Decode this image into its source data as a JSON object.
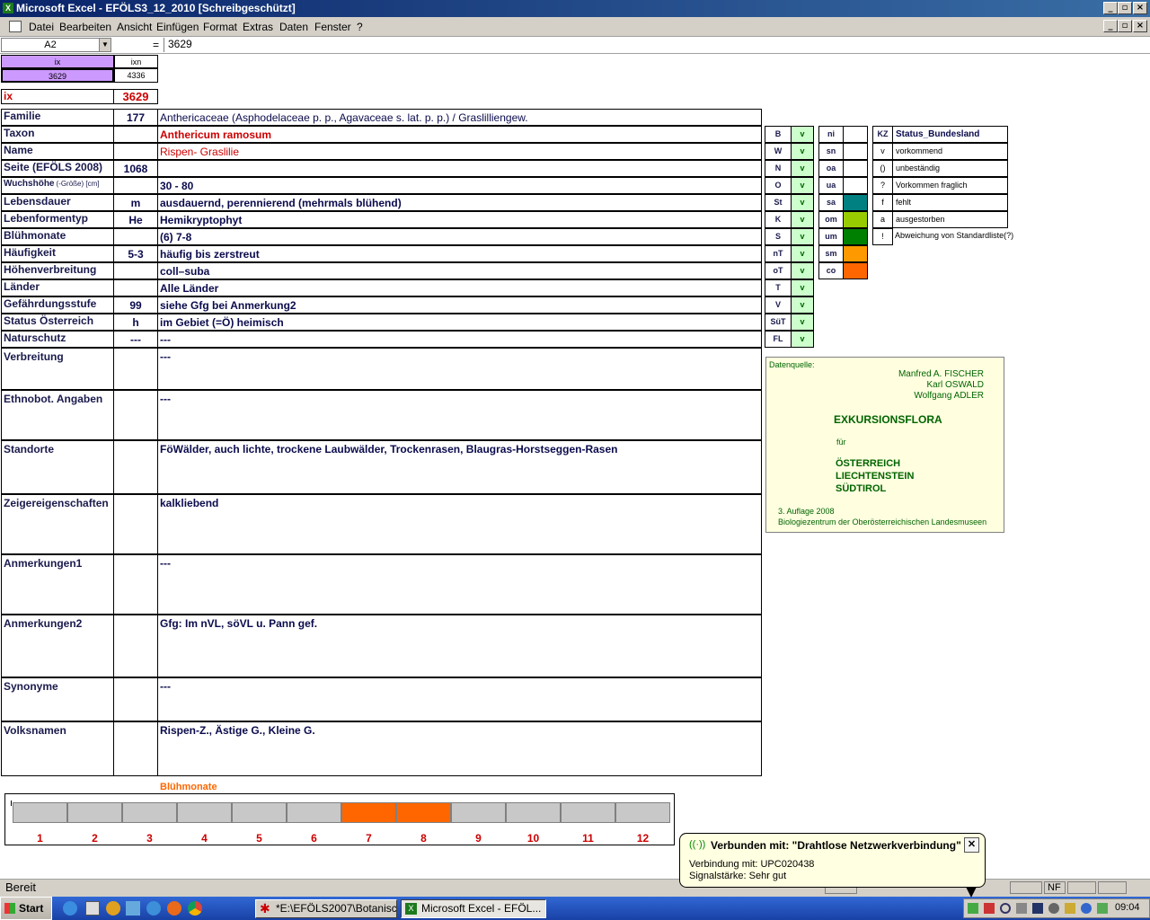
{
  "window": {
    "title": "Microsoft Excel - EFÖLS3_12_2010  [Schreibgeschützt]"
  },
  "menu": {
    "items": [
      "Datei",
      "Bearbeiten",
      "Ansicht",
      "Einfügen",
      "Format",
      "Extras",
      "Daten",
      "Fenster",
      "?"
    ]
  },
  "formula": {
    "namebox": "A2",
    "eq": "=",
    "content": "3629"
  },
  "top": {
    "ix_hdr": "ix",
    "ixn_hdr": "ixn",
    "ix_val": "3629",
    "ixn_val": "4336",
    "ix_label": "ix",
    "ix_big": "3629"
  },
  "rows": [
    {
      "label": "Familie",
      "code": "177",
      "value": "Anthericaceae (Asphodelaceae p. p., Agavaceae s. lat. p. p.)  /  Graslilliengew."
    },
    {
      "label": "Taxon",
      "code": "",
      "value": "Anthericum ramosum"
    },
    {
      "label": "Name",
      "code": "",
      "value": "Rispen- Graslilie"
    },
    {
      "label": "Seite (EFÖLS 2008)",
      "code": "1068",
      "value": ""
    },
    {
      "label": "Wuchshöhe",
      "sub": "(-Größe) [cm]",
      "code": "",
      "value": " 30 - 80"
    },
    {
      "label": "Lebensdauer",
      "code": "m",
      "value": "ausdauernd, perennierend (mehrmals blühend)"
    },
    {
      "label": "Lebenformentyp",
      "code": "He",
      "value": "Hemikryptophyt"
    },
    {
      "label": "Blühmonate",
      "code": "",
      "value": "(6) 7-8"
    },
    {
      "label": "Häufigkeit",
      "code": "5-3",
      "value": "häufig bis zerstreut"
    },
    {
      "label": "Höhenverbreitung",
      "code": "",
      "value": "coll–suba"
    },
    {
      "label": "Länder",
      "code": "",
      "value": "Alle Länder"
    },
    {
      "label": "Gefährdungsstufe",
      "code": "99",
      "value": "siehe Gfg bei Anmerkung2"
    },
    {
      "label": "Status Österreich",
      "code": "h",
      "value": "im Gebiet (=Ö) heimisch"
    },
    {
      "label": "Naturschutz",
      "code": "---",
      "value": " ---"
    }
  ],
  "tall_rows": [
    {
      "label": "Verbreitung",
      "value": " ---"
    },
    {
      "label": "Ethnobot. Angaben",
      "value": "---"
    },
    {
      "label": "Standorte",
      "value": "FöWälder, auch lichte, trockene Laubwälder, Trockenrasen, Blaugras-Horstseggen-Rasen"
    },
    {
      "label": "Zeigereigenschaften",
      "value": "kalkliebend"
    },
    {
      "label": "Anmerkungen1",
      "value": "---"
    },
    {
      "label": "Anmerkungen2",
      "value": "Gfg:  Im nVL, söVL u. Pann gef."
    },
    {
      "label": "Synonyme",
      "value": "---"
    },
    {
      "label": "Volksnamen",
      "value": "Rispen-Z., Ästige G., Kleine G."
    }
  ],
  "states": [
    {
      "k": "B",
      "v": "v"
    },
    {
      "k": "W",
      "v": "v"
    },
    {
      "k": "N",
      "v": "v"
    },
    {
      "k": "O",
      "v": "v"
    },
    {
      "k": "St",
      "v": "v"
    },
    {
      "k": "K",
      "v": "v"
    },
    {
      "k": "S",
      "v": "v"
    },
    {
      "k": "nT",
      "v": "v"
    },
    {
      "k": "oT",
      "v": "v"
    },
    {
      "k": "T",
      "v": "v"
    },
    {
      "k": "V",
      "v": "v"
    },
    {
      "k": "SüT",
      "v": "v"
    },
    {
      "k": "FL",
      "v": "v"
    }
  ],
  "altitude": [
    {
      "k": "ni",
      "color": ""
    },
    {
      "k": "sn",
      "color": ""
    },
    {
      "k": "oa",
      "color": ""
    },
    {
      "k": "ua",
      "color": ""
    },
    {
      "k": "sa",
      "color": "#008080"
    },
    {
      "k": "om",
      "color": "#99cc00"
    },
    {
      "k": "um",
      "color": "#008000"
    },
    {
      "k": "sm",
      "color": "#ff9900"
    },
    {
      "k": "co",
      "color": "#ff6600"
    }
  ],
  "legend": {
    "kz": "KZ",
    "title": "Status_Bundesland",
    "items": [
      {
        "k": "v",
        "t": "vorkommend"
      },
      {
        "k": "()",
        "t": "unbeständig"
      },
      {
        "k": "?",
        "t": "Vorkommen fraglich"
      },
      {
        "k": "f",
        "t": "fehlt"
      },
      {
        "k": "a",
        "t": "ausgestorben"
      },
      {
        "k": "!",
        "t": "Abweichung von Standardliste(?)"
      }
    ]
  },
  "source": {
    "hdr": "Datenquelle:",
    "a1": "Manfred A. FISCHER",
    "a2": "Karl OSWALD",
    "a3": "Wolfgang ADLER",
    "title": "EXKURSIONSFLORA",
    "fuer": "für",
    "c1": "ÖSTERREICH",
    "c2": "LIECHTENSTEIN",
    "c3": "SÜDTIROL",
    "ed": "3. Auflage 2008",
    "pub": "Biologiezentrum der Oberösterreichischen Landesmuseen"
  },
  "months": {
    "title": "Blühmonate",
    "labels": [
      "1",
      "2",
      "3",
      "4",
      "5",
      "6",
      "7",
      "8",
      "9",
      "10",
      "11",
      "12"
    ],
    "active": [
      7,
      8
    ],
    "active_color": "#ff6600"
  },
  "status": {
    "text": "Bereit",
    "nf": "NF"
  },
  "taskbar": {
    "start": "Start",
    "t1": "*E:\\EFÖLS2007\\Botanisc...",
    "t2": "Microsoft Excel - EFÖL...",
    "clock": "09:04"
  },
  "balloon": {
    "title": "Verbunden mit: \"Drahtlose Netzwerkverbindung\"",
    "l1": "Verbindung mit: UPC020438",
    "l2": "Signalstärke: Sehr gut"
  }
}
